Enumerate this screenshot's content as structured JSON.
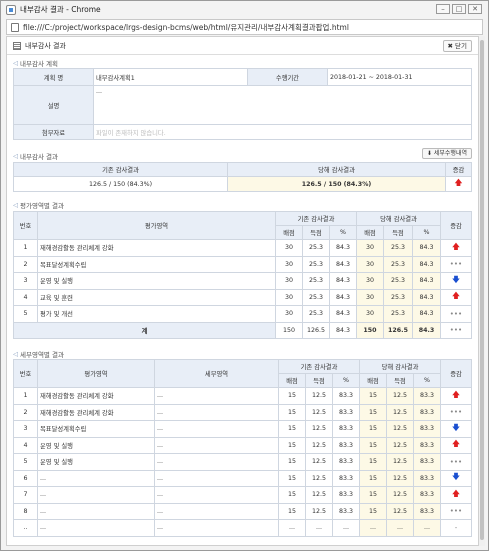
{
  "window": {
    "title": "내부감사 결과 - Chrome",
    "address": "file:///C:/project/workspace/lrgs-design-bcms/web/html/유지관리/내부감사계획결과팝업.html"
  },
  "header": {
    "title": "내부감사 결과",
    "close_label": "닫기"
  },
  "plan_section": {
    "title": "내부감사 계획",
    "plan_name_label": "계획 명",
    "plan_name_value": "내부감사계획1",
    "period_label": "수행기간",
    "period_value": "2018-01-21 ~ 2018-01-31",
    "desc_label": "설명",
    "desc_value": "...",
    "attach_label": "첨부자료",
    "attach_value": "파일이 존재하지 않습니다."
  },
  "result_section": {
    "title": "내부감사 결과",
    "detail_button": "세부수행내역",
    "col_prev": "기존 감사결과",
    "col_curr": "당해 감사결과",
    "col_change": "증감",
    "prev_value": "126.5 / 150 (84.3%)",
    "curr_value": "126.5 / 150 (84.3%)",
    "change": "up"
  },
  "area_section": {
    "title": "평가영역별 결과",
    "headers": {
      "no": "번호",
      "area": "평가영역",
      "prev": "기존 감사결과",
      "curr": "당해 감사결과",
      "change": "증감",
      "alloc": "배점",
      "score": "득점",
      "pct": "%"
    },
    "rows": [
      {
        "no": "1",
        "area": "재해경감활동 관리체계 강화",
        "p_alloc": "30",
        "p_score": "25.3",
        "p_pct": "84.3",
        "c_alloc": "30",
        "c_score": "25.3",
        "c_pct": "84.3",
        "change": "up"
      },
      {
        "no": "2",
        "area": "목표달성계획수립",
        "p_alloc": "30",
        "p_score": "25.3",
        "p_pct": "84.3",
        "c_alloc": "30",
        "c_score": "25.3",
        "c_pct": "84.3",
        "change": "same"
      },
      {
        "no": "3",
        "area": "운영 및 실행",
        "p_alloc": "30",
        "p_score": "25.3",
        "p_pct": "84.3",
        "c_alloc": "30",
        "c_score": "25.3",
        "c_pct": "84.3",
        "change": "down"
      },
      {
        "no": "4",
        "area": "교육 및 훈련",
        "p_alloc": "30",
        "p_score": "25.3",
        "p_pct": "84.3",
        "c_alloc": "30",
        "c_score": "25.3",
        "c_pct": "84.3",
        "change": "up"
      },
      {
        "no": "5",
        "area": "평가 및 개선",
        "p_alloc": "30",
        "p_score": "25.3",
        "p_pct": "84.3",
        "c_alloc": "30",
        "c_score": "25.3",
        "c_pct": "84.3",
        "change": "same"
      }
    ],
    "total": {
      "label": "계",
      "p_alloc": "150",
      "p_score": "126.5",
      "p_pct": "84.3",
      "c_alloc": "150",
      "c_score": "126.5",
      "c_pct": "84.3",
      "change": "same"
    }
  },
  "detail_section": {
    "title": "세부영역별 결과",
    "headers": {
      "no": "번호",
      "area": "평가영역",
      "sub": "세부영역",
      "prev": "기존 감사결과",
      "curr": "당해 감사결과",
      "change": "증감",
      "alloc": "배점",
      "score": "득점",
      "pct": "%"
    },
    "rows": [
      {
        "no": "1",
        "area": "재해경감활동 관리체계 강화",
        "sub": "...",
        "p_alloc": "15",
        "p_score": "12.5",
        "p_pct": "83.3",
        "c_alloc": "15",
        "c_score": "12.5",
        "c_pct": "83.3",
        "change": "up"
      },
      {
        "no": "2",
        "area": "재해경감활동 관리체계 강화",
        "sub": "...",
        "p_alloc": "15",
        "p_score": "12.5",
        "p_pct": "83.3",
        "c_alloc": "15",
        "c_score": "12.5",
        "c_pct": "83.3",
        "change": "same"
      },
      {
        "no": "3",
        "area": "목표달성계획수립",
        "sub": "...",
        "p_alloc": "15",
        "p_score": "12.5",
        "p_pct": "83.3",
        "c_alloc": "15",
        "c_score": "12.5",
        "c_pct": "83.3",
        "change": "down"
      },
      {
        "no": "4",
        "area": "운영 및 실행",
        "sub": "...",
        "p_alloc": "15",
        "p_score": "12.5",
        "p_pct": "83.3",
        "c_alloc": "15",
        "c_score": "12.5",
        "c_pct": "83.3",
        "change": "up"
      },
      {
        "no": "5",
        "area": "운영 및 실행",
        "sub": "...",
        "p_alloc": "15",
        "p_score": "12.5",
        "p_pct": "83.3",
        "c_alloc": "15",
        "c_score": "12.5",
        "c_pct": "83.3",
        "change": "same"
      },
      {
        "no": "6",
        "area": "...",
        "sub": "...",
        "p_alloc": "15",
        "p_score": "12.5",
        "p_pct": "83.3",
        "c_alloc": "15",
        "c_score": "12.5",
        "c_pct": "83.3",
        "change": "down"
      },
      {
        "no": "7",
        "area": "...",
        "sub": "...",
        "p_alloc": "15",
        "p_score": "12.5",
        "p_pct": "83.3",
        "c_alloc": "15",
        "c_score": "12.5",
        "c_pct": "83.3",
        "change": "up"
      },
      {
        "no": "8",
        "area": "...",
        "sub": "...",
        "p_alloc": "15",
        "p_score": "12.5",
        "p_pct": "83.3",
        "c_alloc": "15",
        "c_score": "12.5",
        "c_pct": "83.3",
        "change": "same"
      },
      {
        "no": "..",
        "area": "...",
        "sub": "...",
        "p_alloc": "...",
        "p_score": "...",
        "p_pct": "...",
        "c_alloc": "...",
        "c_score": "...",
        "c_pct": "...",
        "change": "none"
      }
    ]
  },
  "colors": {
    "up": "#e02020",
    "down": "#1a4fd0",
    "header_bg": "#e8eef7",
    "current_bg": "#fdf9e6"
  }
}
